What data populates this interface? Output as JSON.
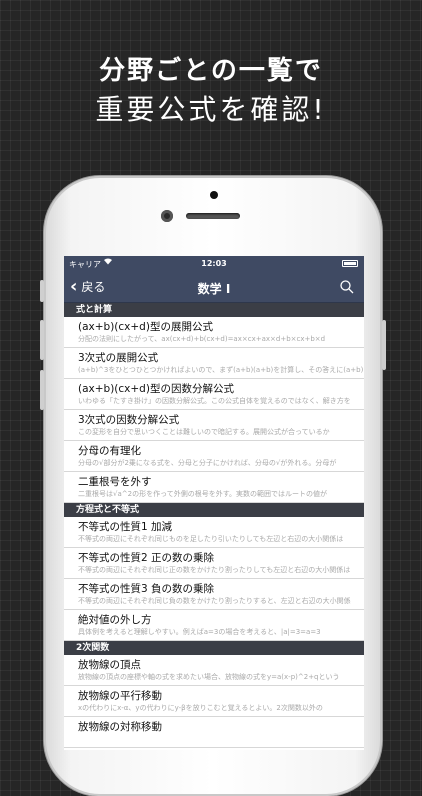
{
  "promo": {
    "line1": "分野ごとの一覧で",
    "line2": "重要公式を確認!"
  },
  "status_bar": {
    "carrier": "キャリア",
    "wifi_icon": "wifi-icon",
    "time": "12:03",
    "battery_icon": "battery-icon"
  },
  "nav": {
    "back_label": "戻る",
    "title": "数学 I",
    "search_icon": "search-icon",
    "color": "#3f4a63"
  },
  "sections": [
    {
      "header": "式と計算",
      "items": [
        {
          "title": "(ax+b)(cx+d)型の展開公式",
          "sub": "分配の法則にしたがって、ax(cx+d)+b(cx+d)=ax×cx+ax×d+b×cx+b×d"
        },
        {
          "title": "3次式の展開公式",
          "sub": "(a+b)^3をひとつひとつかければよいので、まず(a+b)(a+b)を計算し、その答えに(a+b)を"
        },
        {
          "title": "(ax+b)(cx+d)型の因数分解公式",
          "sub": "いわゆる「たすき掛け」の因数分解公式。この公式自体を覚えるのではなく、解き方を"
        },
        {
          "title": "3次式の因数分解公式",
          "sub": "この変形を自分で思いつくことは難しいので暗記する。展開公式が合っているか"
        },
        {
          "title": "分母の有理化",
          "sub": "分母の√部分が2乗になる式を、分母と分子にかければ、分母の√が外れる。分母が"
        },
        {
          "title": "二重根号を外す",
          "sub": "二重根号は√a^2の形を作って外側の根号を外す。実数の範囲ではルートの値が"
        }
      ]
    },
    {
      "header": "方程式と不等式",
      "items": [
        {
          "title": "不等式の性質1 加減",
          "sub": "不等式の両辺にそれぞれ同じものを足したり引いたりしても左辺と右辺の大小関係は"
        },
        {
          "title": "不等式の性質2 正の数の乗除",
          "sub": "不等式の両辺にそれぞれ同じ正の数をかけたり割ったりしても左辺と右辺の大小関係は"
        },
        {
          "title": "不等式の性質3 負の数の乗除",
          "sub": "不等式の両辺にそれぞれ同じ負の数をかけたり割ったりすると、左辺と右辺の大小関係"
        },
        {
          "title": "絶対値の外し方",
          "sub": "具体例を考えると理解しやすい。例えばa=3の場合を考えると、|a|=3=a=3"
        }
      ]
    },
    {
      "header": "2次関数",
      "items": [
        {
          "title": "放物線の頂点",
          "sub": "放物線の頂点の座標や軸の式を求めたい場合、放物線の式をy=a(x-p)^2+qという"
        },
        {
          "title": "放物線の平行移動",
          "sub": "xの代わりにx-α、yの代わりにy-βを放りこむと覚えるとよい。2次関数以外の"
        },
        {
          "title": "放物線の対称移動",
          "sub": ""
        }
      ]
    }
  ]
}
